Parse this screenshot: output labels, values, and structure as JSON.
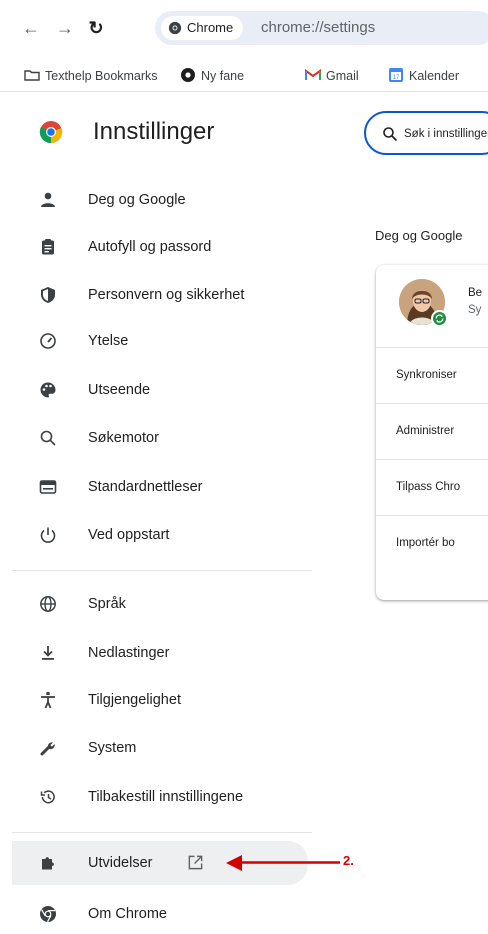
{
  "browser": {
    "chip_label": "Chrome",
    "url": "chrome://settings"
  },
  "bookmarks": [
    {
      "label": "Texthelp Bookmarks",
      "icon": "folder-icon"
    },
    {
      "label": "Ny fane",
      "icon": "chrome-icon"
    },
    {
      "label": "Gmail",
      "icon": "gmail-icon"
    },
    {
      "label": "Kalender",
      "icon": "calendar-icon"
    }
  ],
  "settings": {
    "title": "Innstillinger",
    "search_placeholder": "Søk i innstillinger"
  },
  "sidebar": {
    "items": [
      {
        "label": "Deg og Google",
        "icon": "person-icon"
      },
      {
        "label": "Autofyll og passord",
        "icon": "clipboard-icon"
      },
      {
        "label": "Personvern og sikkerhet",
        "icon": "shield-icon"
      },
      {
        "label": "Ytelse",
        "icon": "speedometer-icon"
      },
      {
        "label": "Utseende",
        "icon": "palette-icon"
      },
      {
        "label": "Søkemotor",
        "icon": "search-icon"
      },
      {
        "label": "Standardnettleser",
        "icon": "browser-window-icon"
      },
      {
        "label": "Ved oppstart",
        "icon": "power-icon"
      },
      {
        "label": "Språk",
        "icon": "globe-icon"
      },
      {
        "label": "Nedlastinger",
        "icon": "download-icon"
      },
      {
        "label": "Tilgjengelighet",
        "icon": "accessibility-icon"
      },
      {
        "label": "System",
        "icon": "wrench-icon"
      },
      {
        "label": "Tilbakestill innstillingene",
        "icon": "history-icon"
      },
      {
        "label": "Utvidelser",
        "icon": "puzzle-icon"
      },
      {
        "label": "Om Chrome",
        "icon": "chrome-icon"
      }
    ]
  },
  "main": {
    "section_title": "Deg og Google",
    "account": {
      "name": "Be",
      "sub": "Sy"
    },
    "rows": [
      "Synkroniser",
      "Administrer",
      "Tilpass Chro",
      "Importér bo"
    ]
  },
  "annotation": {
    "label": "2.",
    "color": "#d40000"
  },
  "colors": {
    "accent": "#0b57d0",
    "active_item_bg": "#eeeff0",
    "sync_badge": "#1e8e3e"
  }
}
